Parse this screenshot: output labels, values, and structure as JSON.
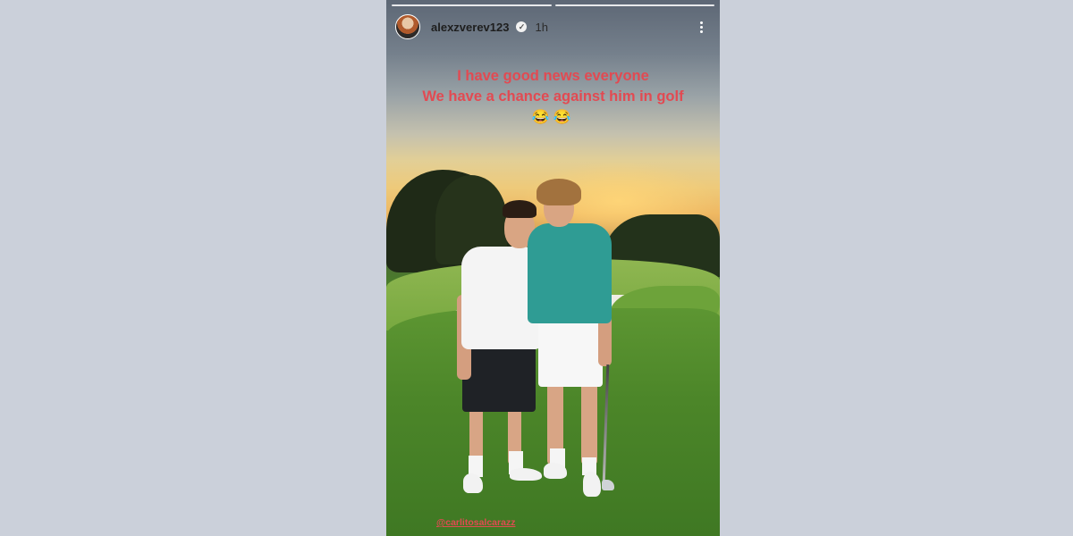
{
  "story": {
    "username": "alexzverev123",
    "time": "1h",
    "caption_line1": "I have good news everyone",
    "caption_line2": "We have a chance against him in golf",
    "caption_emojis": "😂😂",
    "mention": "@carlitosalcarazz"
  },
  "icons": {
    "verified": "verified-badge-icon",
    "more": "more-options-icon"
  },
  "colors": {
    "page_background": "#cbd0da",
    "caption_text": "#e24a52",
    "mention_text": "#e24a52"
  }
}
